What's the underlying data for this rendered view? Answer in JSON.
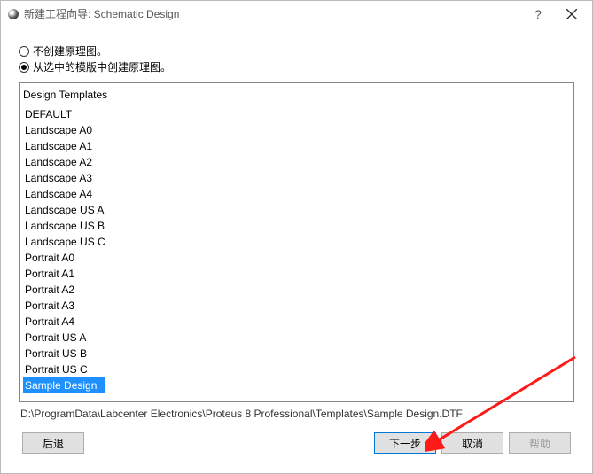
{
  "window": {
    "title": "新建工程向导: Schematic Design"
  },
  "options": {
    "no_schematic": "不创建原理图。",
    "from_template": "从选中的模版中创建原理图。",
    "selected": "from_template"
  },
  "templates": {
    "header": "Design Templates",
    "items": [
      "DEFAULT",
      "Landscape A0",
      "Landscape A1",
      "Landscape A2",
      "Landscape A3",
      "Landscape A4",
      "Landscape US A",
      "Landscape US B",
      "Landscape US C",
      "Portrait A0",
      "Portrait A1",
      "Portrait A2",
      "Portrait A3",
      "Portrait A4",
      "Portrait US A",
      "Portrait US B",
      "Portrait US C",
      "Sample Design"
    ],
    "selected_index": 17
  },
  "path": "D:\\ProgramData\\Labcenter Electronics\\Proteus 8 Professional\\Templates\\Sample Design.DTF",
  "buttons": {
    "back": "后退",
    "next": "下一步",
    "cancel": "取消",
    "help": "帮助"
  }
}
